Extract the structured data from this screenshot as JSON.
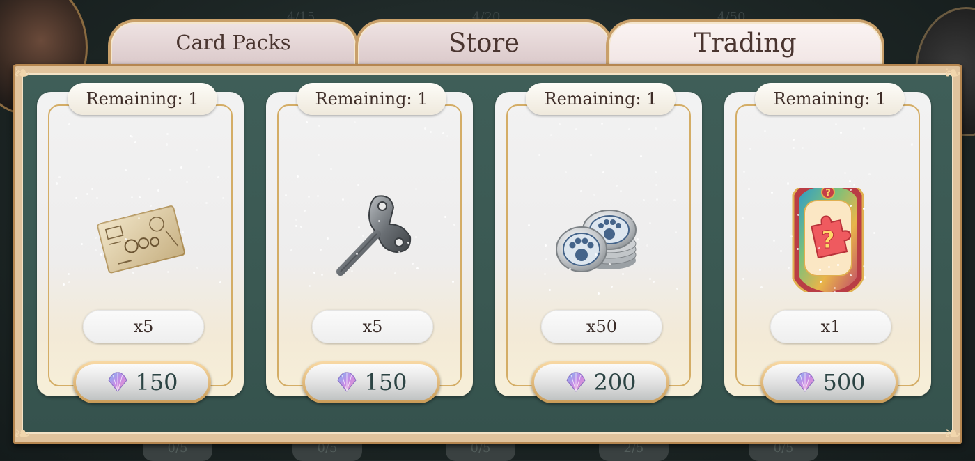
{
  "background": {
    "faded_counters_top": [
      "4/15",
      "4/20",
      "4/50"
    ],
    "faded_counters_bottom": [
      "0/5",
      "0/5",
      "0/5",
      "2/5",
      "0/5"
    ]
  },
  "tabs": [
    {
      "label": "Card Packs",
      "active": false
    },
    {
      "label": "Store",
      "active": false
    },
    {
      "label": "Trading",
      "active": true
    }
  ],
  "currency_icon": "shell-icon",
  "items": [
    {
      "remaining": "Remaining: 1",
      "icon": "blueprint-map-icon",
      "quantity": "x5",
      "price": "150"
    },
    {
      "remaining": "Remaining: 1",
      "icon": "windup-key-icon",
      "quantity": "x5",
      "price": "150"
    },
    {
      "remaining": "Remaining: 1",
      "icon": "paw-coins-icon",
      "quantity": "x50",
      "price": "200"
    },
    {
      "remaining": "Remaining: 1",
      "icon": "mystery-puzzle-badge-icon",
      "quantity": "x1",
      "price": "500"
    }
  ],
  "colors": {
    "panel_green": "#3f5e58",
    "gold_border": "#c9a06a",
    "price_text": "#2c4444"
  }
}
